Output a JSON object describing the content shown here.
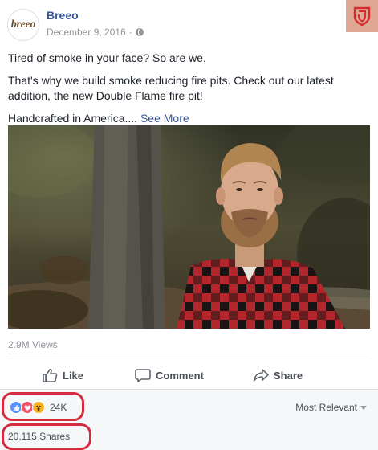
{
  "post": {
    "author": "Breeo",
    "avatar_text": "breeo",
    "date": "December 9, 2016",
    "separator": "·",
    "privacy_icon": "globe-icon",
    "paragraphs": [
      "Tired of smoke in your face? So are we.",
      "That's why we build smoke reducing fire pits. Check out our latest addition, the new Double Flame fire pit!"
    ],
    "truncated_text": "Handcrafted in America.... ",
    "see_more": "See More",
    "views": "2.9M Views"
  },
  "actions": {
    "like": "Like",
    "comment": "Comment",
    "share": "Share"
  },
  "reactions": {
    "icons": [
      "like-icon",
      "love-icon",
      "wow-icon"
    ],
    "count": "24K",
    "sort_label": "Most Relevant",
    "shares": "20,115 Shares"
  },
  "colors": {
    "link": "#365899",
    "annotation_ring": "#d62b3f",
    "brand_badge": "#e0a894"
  }
}
